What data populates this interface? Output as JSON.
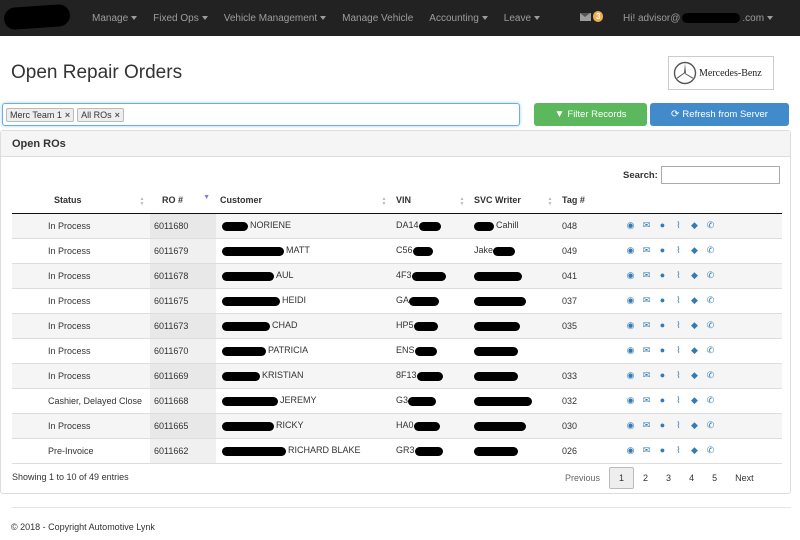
{
  "nav": {
    "items": [
      "Manage",
      "Fixed Ops",
      "Vehicle Management",
      "Manage Vehicle",
      "Accounting",
      "Leave"
    ],
    "has_caret": [
      true,
      true,
      true,
      false,
      true,
      true
    ],
    "mail_count": "3",
    "user_prefix": "Hi! advisor@",
    "user_suffix": ".com"
  },
  "header": {
    "title": "Open Repair Orders",
    "brand": "Mercedes-Benz"
  },
  "filters": {
    "tags": [
      "Merc Team 1",
      "All ROs"
    ],
    "filter_label": "Filter Records",
    "refresh_label": "Refresh from Server"
  },
  "panel": {
    "title": "Open ROs",
    "search_label": "Search:"
  },
  "table": {
    "columns": [
      "Status",
      "RO #",
      "Customer",
      "VIN",
      "SVC Writer",
      "Tag #",
      ""
    ],
    "rows": [
      {
        "status": "In Process",
        "ro": "6011680",
        "customer": "NORIENE",
        "vin": "DA14",
        "writer": "Cahill",
        "tag": "048"
      },
      {
        "status": "In Process",
        "ro": "6011679",
        "customer": "MATT",
        "vin": "C56",
        "writer": "Jake",
        "tag": "049"
      },
      {
        "status": "In Process",
        "ro": "6011678",
        "customer": "AUL",
        "vin": "4F3",
        "writer": "",
        "tag": "041"
      },
      {
        "status": "In Process",
        "ro": "6011675",
        "customer": "HEIDI",
        "vin": "GA",
        "writer": "",
        "tag": "037"
      },
      {
        "status": "In Process",
        "ro": "6011673",
        "customer": "CHAD",
        "vin": "HP5",
        "writer": "",
        "tag": "035"
      },
      {
        "status": "In Process",
        "ro": "6011670",
        "customer": "PATRICIA",
        "vin": "ENS",
        "writer": "",
        "tag": ""
      },
      {
        "status": "In Process",
        "ro": "6011669",
        "customer": "KRISTIAN",
        "vin": "8F13",
        "writer": "",
        "tag": "033"
      },
      {
        "status": "Cashier, Delayed Close",
        "ro": "6011668",
        "customer": "JEREMY",
        "vin": "G3",
        "writer": "",
        "tag": "032"
      },
      {
        "status": "In Process",
        "ro": "6011665",
        "customer": "RICKY",
        "vin": "HA0",
        "writer": "",
        "tag": "030"
      },
      {
        "status": "Pre-Invoice",
        "ro": "6011662",
        "customer": "RICHARD BLAKE",
        "vin": "GR3",
        "writer": "",
        "tag": "026"
      }
    ]
  },
  "footer_info": {
    "entries": "Showing 1 to 10 of 49 entries",
    "pages": [
      "Previous",
      "1",
      "2",
      "3",
      "4",
      "5",
      "Next"
    ]
  },
  "copyright": "© 2018 - Copyright Automotive Lynk"
}
